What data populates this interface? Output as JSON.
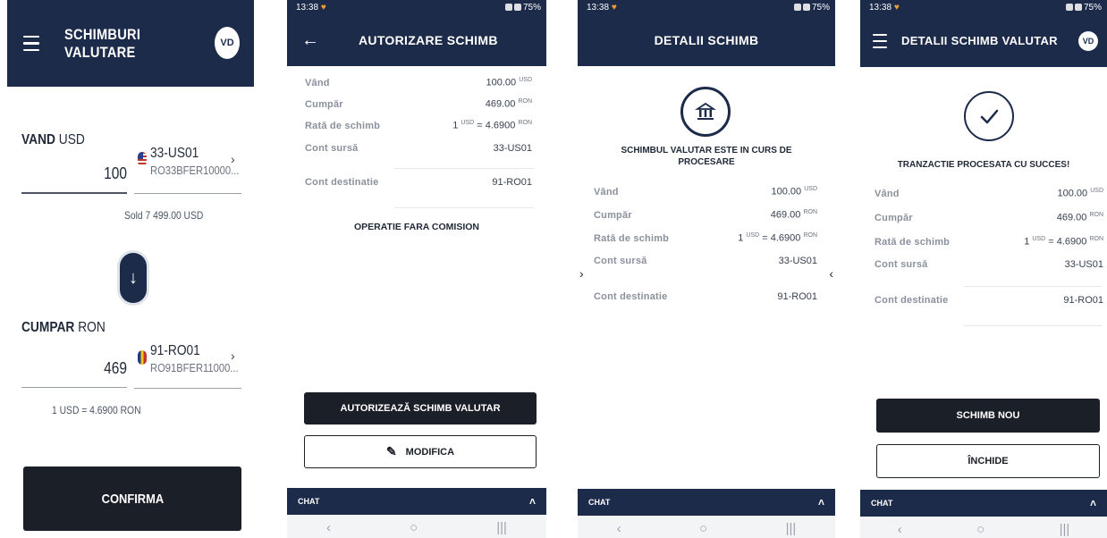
{
  "screen1": {
    "title": "SCHIMBURI VALUTARE",
    "avatar": "VD",
    "sell_bold": "VAND",
    "sell_currency": " USD",
    "sell_amount": "100",
    "sell_account": "33-US01",
    "sell_iban": "RO33BFER10000...",
    "sell_balance": "Sold 7 499.00 USD",
    "buy_bold": "CUMPAR",
    "buy_currency": " RON",
    "buy_amount": "469",
    "buy_account": "91-RO01",
    "buy_iban": "RO91BFER11000...",
    "rate": "1 USD = 4.6900 RON",
    "confirm": "CONFIRMA",
    "swap_icon": "arrow-down-icon"
  },
  "screen2": {
    "time": "13:38",
    "battery": "75%",
    "title": "AUTORIZARE SCHIMB",
    "rows": [
      {
        "label": "Vând",
        "value": "100.00",
        "unit": "USD"
      },
      {
        "label": "Cumpăr",
        "value": "469.00",
        "unit": "RON"
      },
      {
        "label": "Rată de schimb",
        "value_pre": "1",
        "unit_pre": "USD",
        "value": " = 4.6900",
        "unit": "RON"
      },
      {
        "label": "Cont sursă",
        "value": "33-US01",
        "unit": ""
      },
      {
        "label": "Cont destinatie",
        "value": "91-RO01",
        "unit": ""
      }
    ],
    "no_fee": "OPERATIE FARA COMISION",
    "authorize": "AUTORIZEAZĂ SCHIMB VALUTAR",
    "modify": "MODIFICA",
    "chat": "CHAT"
  },
  "screen3": {
    "time": "13:38",
    "battery": "75%",
    "title": "DETALII SCHIMB",
    "status_line1": "SCHIMBUL VALUTAR ESTE IN CURS DE",
    "status_line2": "PROCESARE",
    "rows": [
      {
        "label": "Vând",
        "value": "100.00",
        "unit": "USD"
      },
      {
        "label": "Cumpăr",
        "value": "469.00",
        "unit": "RON"
      },
      {
        "label": "Rată de schimb",
        "value_pre": "1",
        "unit_pre": "USD",
        "value": " = 4.6900",
        "unit": "RON"
      },
      {
        "label": "Cont sursă",
        "value": "33-US01",
        "unit": ""
      },
      {
        "label": "Cont destinatie",
        "value": "91-RO01",
        "unit": ""
      }
    ],
    "chat": "CHAT"
  },
  "screen4": {
    "time": "13:38",
    "battery": "75%",
    "title": "DETALII SCHIMB VALUTAR",
    "avatar": "VD",
    "status": "TRANZACTIE PROCESATA CU SUCCES!",
    "rows": [
      {
        "label": "Vând",
        "value": "100.00",
        "unit": "USD"
      },
      {
        "label": "Cumpăr",
        "value": "469.00",
        "unit": "RON"
      },
      {
        "label": "Rată de schimb",
        "value_pre": "1",
        "unit_pre": "USD",
        "value": " = 4.6900",
        "unit": "RON"
      },
      {
        "label": "Cont sursă",
        "value": "33-US01",
        "unit": ""
      },
      {
        "label": "Cont destinatie",
        "value": "91-RO01",
        "unit": ""
      }
    ],
    "new_exchange": "SCHIMB NOU",
    "close": "ÎNCHIDE",
    "chat": "CHAT"
  },
  "colors": {
    "navy": "#1d2b4a",
    "button_dark": "#1b1f27"
  }
}
